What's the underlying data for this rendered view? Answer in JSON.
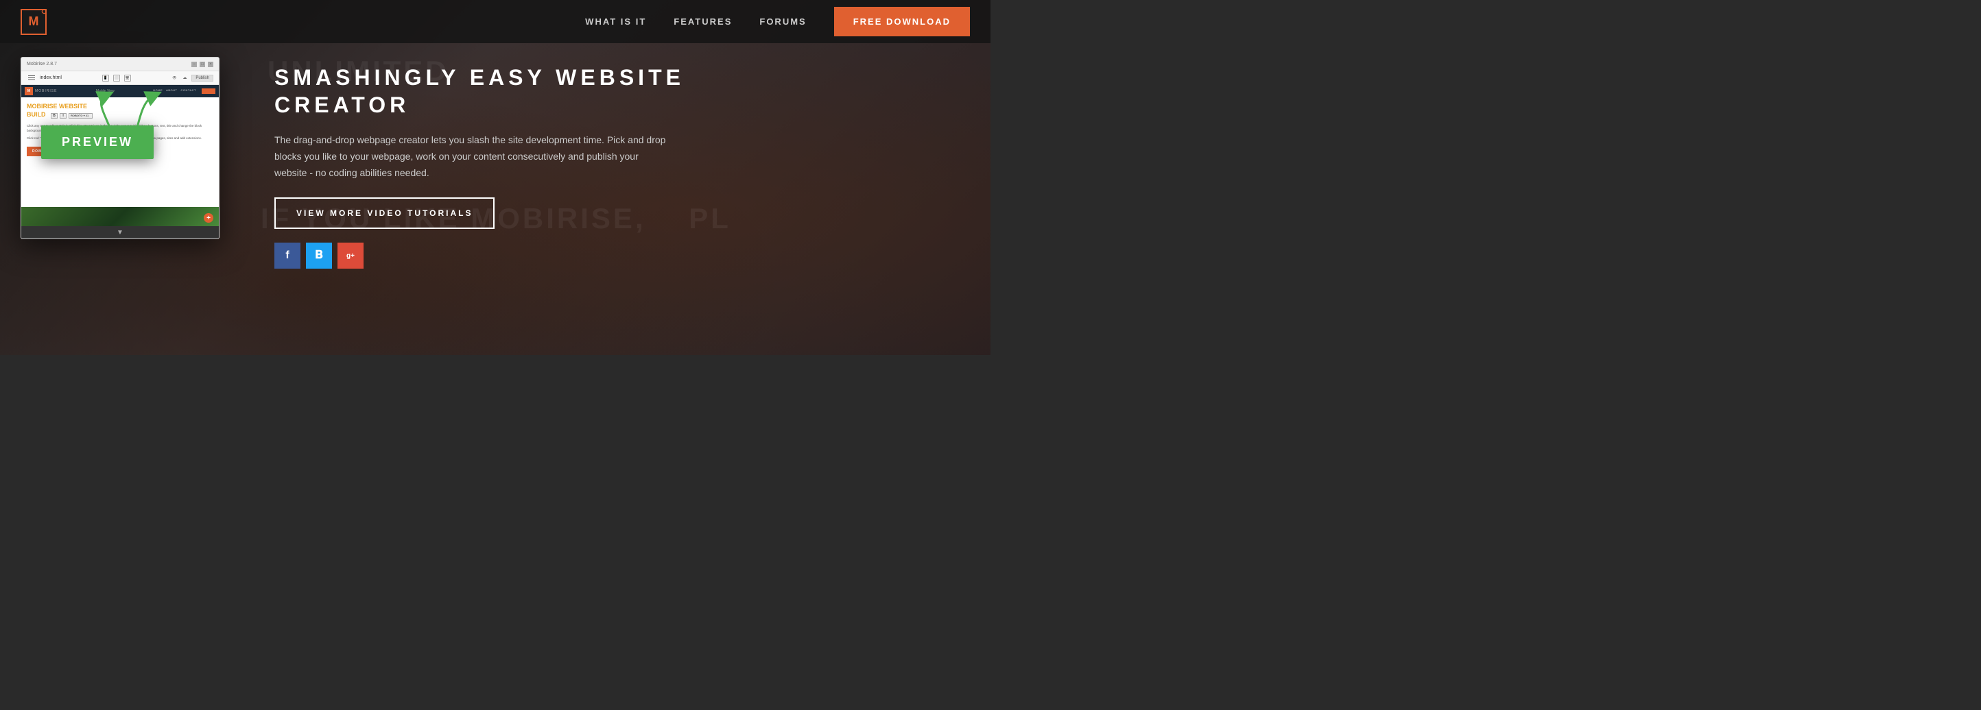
{
  "navbar": {
    "logo_letter": "M",
    "nav_links": [
      {
        "id": "what-is-it",
        "label": "WHAT IS IT"
      },
      {
        "id": "features",
        "label": "FEATURES"
      },
      {
        "id": "forums",
        "label": "FORUMS"
      }
    ],
    "download_btn": "FREE DOWNLOAD"
  },
  "mockup": {
    "title": "Mobirise 2.8.7",
    "filename": "index.html",
    "publish_label": "Publish",
    "brand": "MOBIRISE",
    "mobile_label": "Mobile View",
    "nav_links": [
      "HOME",
      "ABOUT",
      "CONTACT"
    ],
    "heading_line1": "MOBIRISE WEBSITE",
    "heading_line2": "BUILD",
    "body_text_1": "Click any text to edit or style it. Click blue \"Gear\" icon in the top right corner to hide/show buttons, text, title and change the block background.",
    "body_text_2": "Click red \"+\" in the bottom right corner to add a new block. Use the top left menu to create new pages, sites and add extensions.",
    "btn1": "DOWNLOAD NOW",
    "btn2": "FOR WINDOWS & MAC"
  },
  "preview": {
    "label": "PREVIEW"
  },
  "hero": {
    "title_line1": "SMASHINGLY EASY WEBSITE",
    "title_line2": "CREATOR",
    "description": "The drag-and-drop webpage creator lets you slash the site development time. Pick and drop blocks you like to your webpage, work on your content consecutively and publish your website - no coding abilities needed.",
    "watermark1": "UNLIMITED",
    "watermark2": "IF YOU LIKE MOBIRISE,",
    "watermark3": "PL",
    "tutorials_btn": "VIEW MORE VIDEO TUTORIALS",
    "social": {
      "facebook": "f",
      "twitter": "t",
      "googleplus": "g+"
    }
  },
  "colors": {
    "orange": "#e06030",
    "green": "#4caf50",
    "yellow": "#e8a020",
    "dark_bg": "#1e1e1e",
    "nav_bg": "#141414"
  }
}
